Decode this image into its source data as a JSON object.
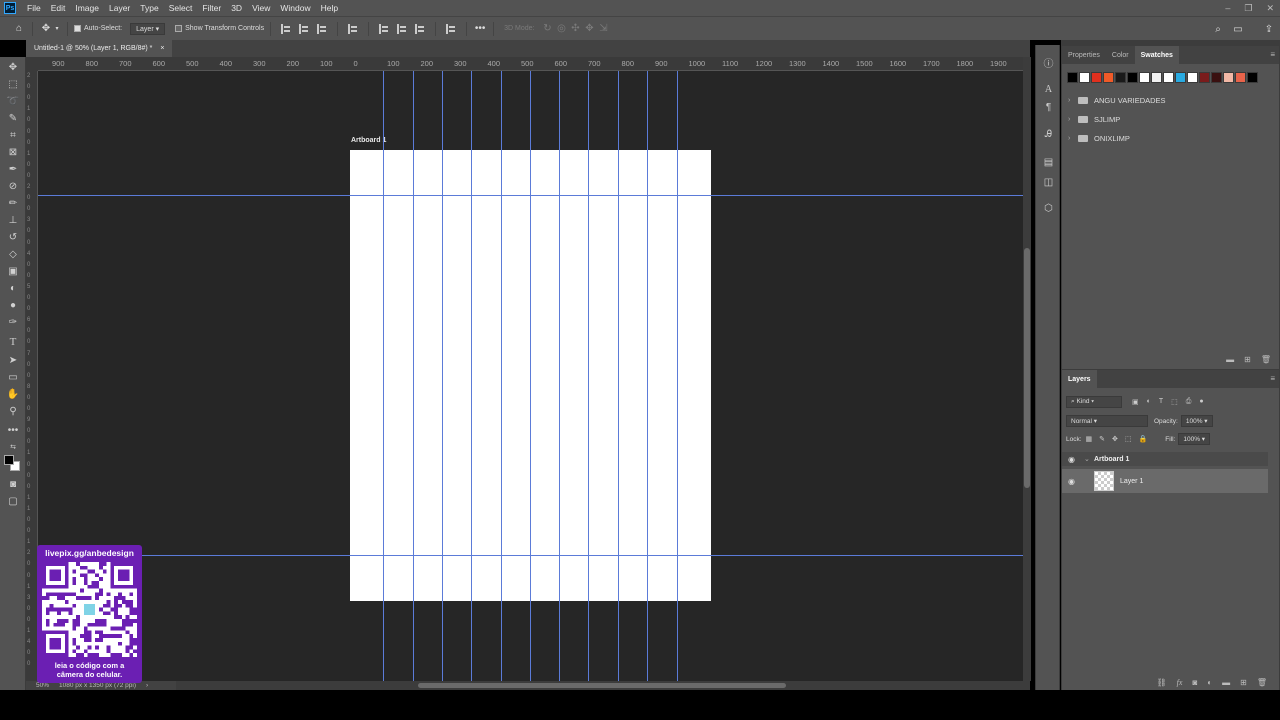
{
  "menubar": {
    "logo": "Ps",
    "items": [
      "File",
      "Edit",
      "Image",
      "Layer",
      "Type",
      "Select",
      "Filter",
      "3D",
      "View",
      "Window",
      "Help"
    ],
    "window_controls": [
      "–",
      "❐",
      "✕"
    ]
  },
  "options": {
    "auto_select_label": "Auto-Select:",
    "auto_select_checked": true,
    "target_select": "Layer",
    "transform_label": "Show Transform Controls",
    "mode_3d_label": "3D Mode:"
  },
  "document": {
    "tab_title": "Untitled-1 @ 50% (Layer 1, RGB/8#) *",
    "close_glyph": "×"
  },
  "ruler": {
    "h_labels": [
      "900",
      "800",
      "700",
      "600",
      "500",
      "400",
      "300",
      "200",
      "100",
      "0",
      "100",
      "200",
      "300",
      "400",
      "500",
      "600",
      "700",
      "800",
      "900",
      "1000",
      "1100",
      "1200",
      "1300",
      "1400",
      "1500",
      "1600",
      "1700",
      "1800",
      "1900",
      "2"
    ],
    "v_labels": [
      "2",
      "0",
      "0",
      "1",
      "0",
      "0",
      "0",
      "1",
      "0",
      "0",
      "2",
      "0",
      "0",
      "3",
      "0",
      "0",
      "4",
      "0",
      "0",
      "5",
      "0",
      "0",
      "6",
      "0",
      "0",
      "7",
      "0",
      "0",
      "8",
      "0",
      "0",
      "9",
      "0",
      "0",
      "1",
      "0",
      "0",
      "0",
      "1",
      "1",
      "0",
      "0",
      "1",
      "2",
      "0",
      "0",
      "1",
      "3",
      "0",
      "0",
      "1",
      "4",
      "0",
      "0"
    ]
  },
  "artboard": {
    "title": "Artboard 1"
  },
  "status": {
    "zoom": "50%",
    "doc_size": "1080 px x 1350 px (72 ppi)",
    "arrow": "›"
  },
  "donation": {
    "url": "livepix.gg/anbedesign",
    "caption_line1": "leia o código com a",
    "caption_line2": "câmera do celular."
  },
  "panels": {
    "top_tabs": [
      "Properties",
      "Color",
      "Swatches"
    ],
    "active_top_tab": "Swatches",
    "swatches": [
      "#000000",
      "#ffffff",
      "#e0301e",
      "#f05a28",
      "#1a1a1a",
      "#000000",
      "#ffffff",
      "#f2f2f2",
      "#ffffff",
      "#29abe2",
      "#ffffff",
      "#7a1c1c",
      "#3a1010",
      "#f2b8a6",
      "#e8634a",
      "#000000"
    ],
    "swatch_groups": [
      "ANGU VARIEDADES",
      "SJLIMP",
      "ONIXLIMP"
    ],
    "layers_tab": "Layers",
    "kind_filter": "Kind",
    "blend_mode": "Normal",
    "opacity_label": "Opacity:",
    "opacity_value": "100%",
    "lock_label": "Lock:",
    "fill_label": "Fill:",
    "fill_value": "100%",
    "artboard_layer": "Artboard 1",
    "layer_name": "Layer 1"
  },
  "colors": {
    "ui_panel": "#535353",
    "canvas_bg": "#262626",
    "guide": "#5b7bd8",
    "donation_purple": "#6b1fb3"
  }
}
